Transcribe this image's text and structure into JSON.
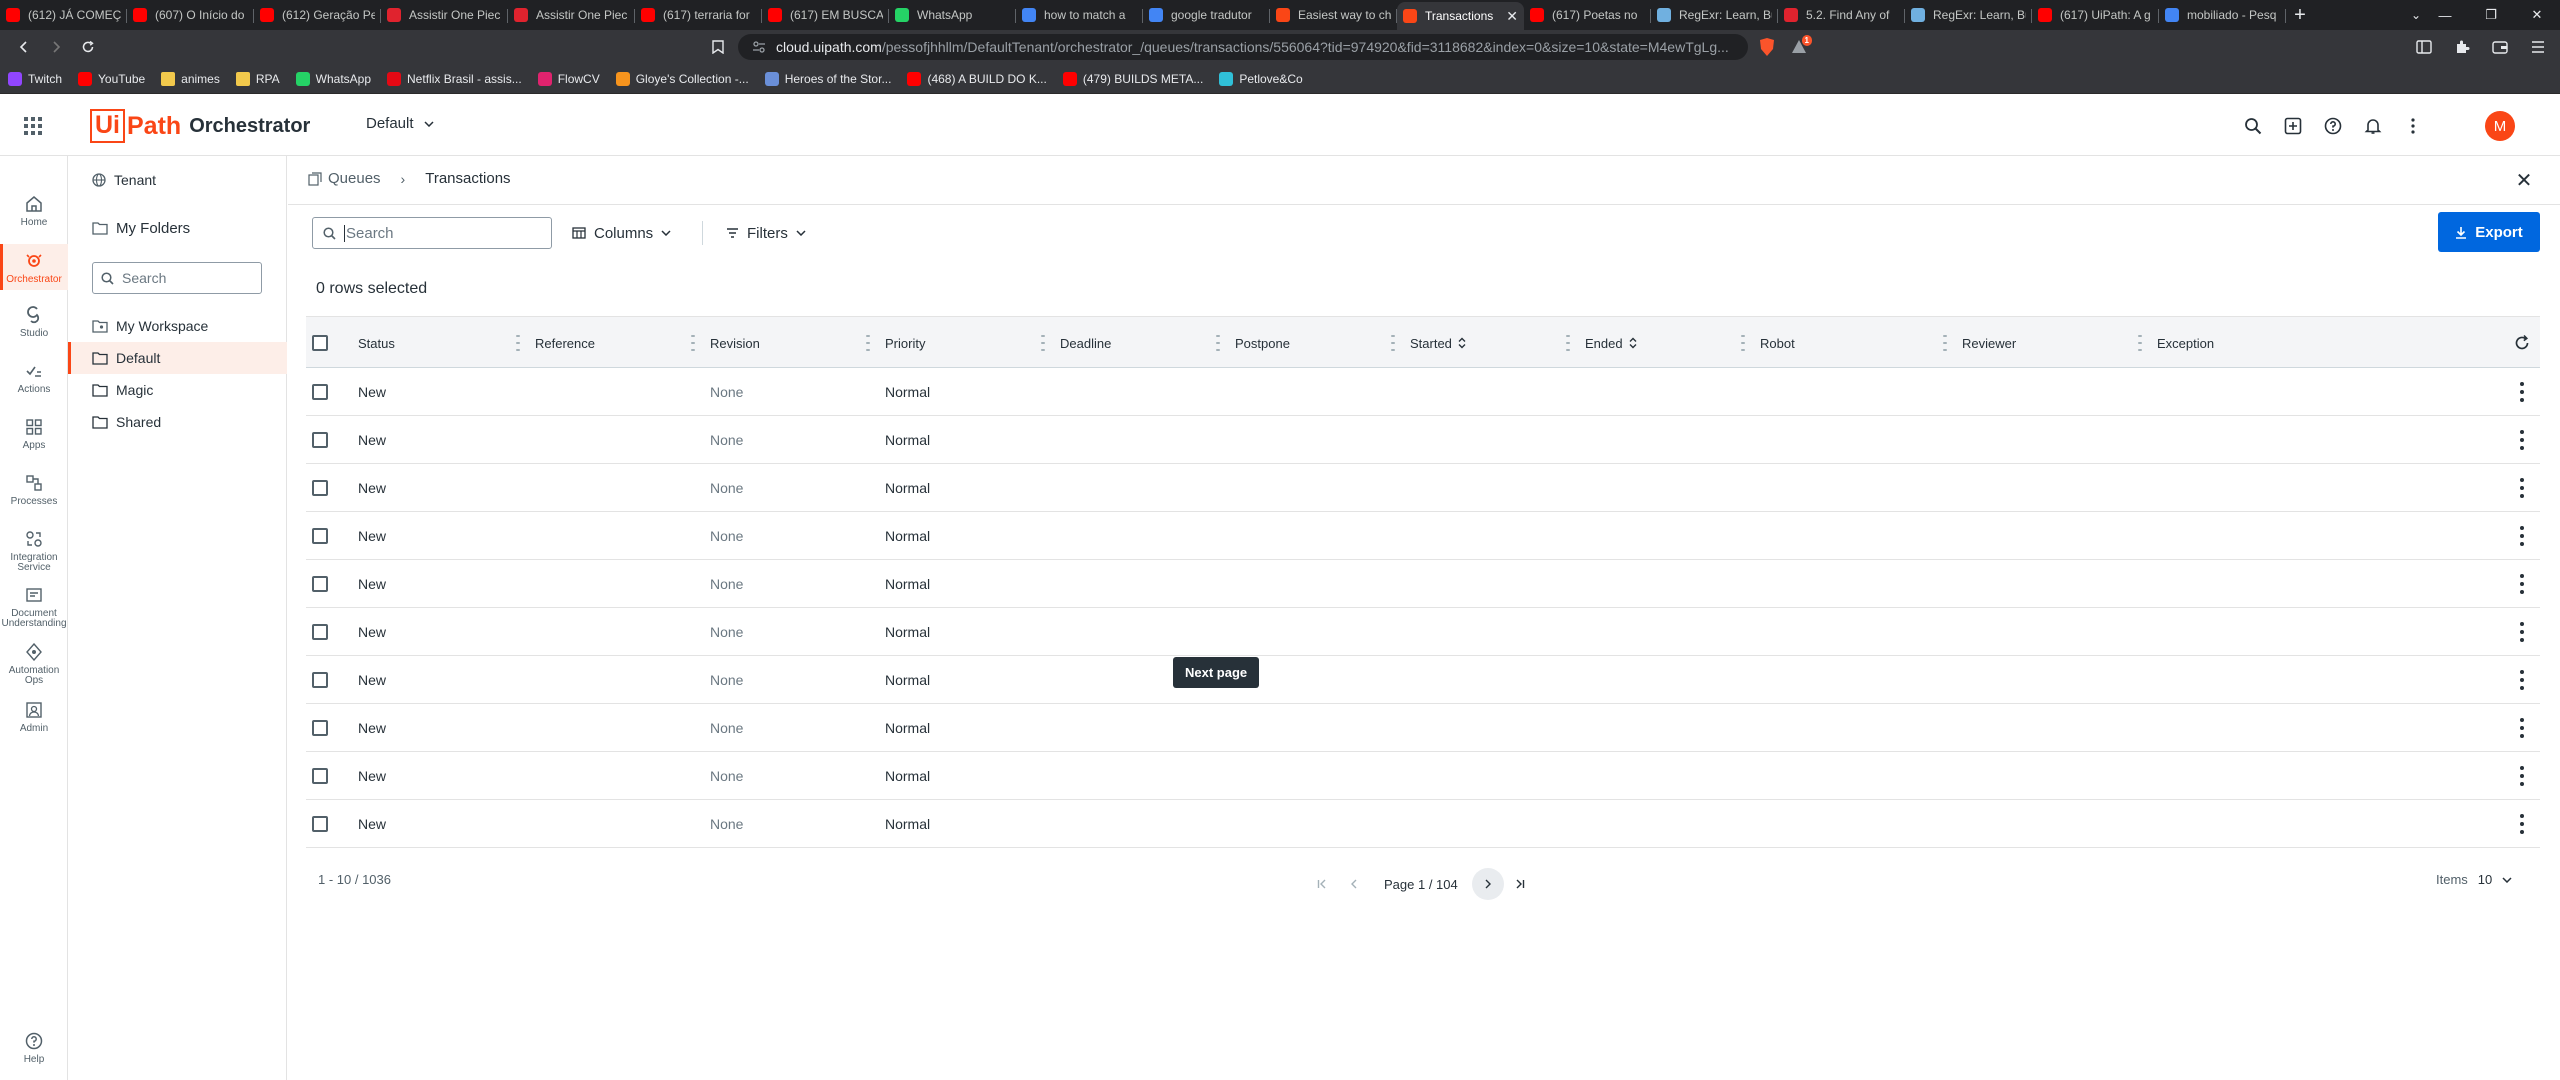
{
  "browser": {
    "tabs": [
      {
        "title": "(612) JÁ COMEÇ",
        "fav": "#ff0000"
      },
      {
        "title": "(607) O Início do",
        "fav": "#ff0000"
      },
      {
        "title": "(612) Geração Pe",
        "fav": "#ff0000"
      },
      {
        "title": "Assistir One Piec",
        "fav": "#e0232e"
      },
      {
        "title": "Assistir One Piec",
        "fav": "#e0232e"
      },
      {
        "title": "(617) terraria for",
        "fav": "#ff0000"
      },
      {
        "title": "(617) EM BUSCA",
        "fav": "#ff0000"
      },
      {
        "title": "WhatsApp",
        "fav": "#25d366"
      },
      {
        "title": "how to match a",
        "fav": "#4285f4"
      },
      {
        "title": "google tradutor",
        "fav": "#4285f4"
      },
      {
        "title": "Easiest way to ch",
        "fav": "#fa4616"
      },
      {
        "title": "Transactions",
        "fav": "#fa4616",
        "active": true
      },
      {
        "title": "(617) Poetas no",
        "fav": "#ff0000"
      },
      {
        "title": "RegExr: Learn, Bu",
        "fav": "#70b0e0"
      },
      {
        "title": "5.2. Find Any of",
        "fav": "#e0232e"
      },
      {
        "title": "RegExr: Learn, Bu",
        "fav": "#70b0e0"
      },
      {
        "title": "(617) UiPath: A g",
        "fav": "#ff0000"
      },
      {
        "title": "mobiliado - Pesq",
        "fav": "#4285f4"
      }
    ],
    "tab_close": "✕",
    "new_tab": "+",
    "url_host": "cloud.uipath.com",
    "url_path": "/pessofjhhllm/DefaultTenant/orchestrator_/queues/transactions/556064?tid=974920&fid=3118682&index=0&size=10&state=M4ewTgLg...",
    "brave_badge": "1",
    "bookmarks": [
      {
        "label": "Twitch",
        "color": "#9146ff"
      },
      {
        "label": "YouTube",
        "color": "#ff0000"
      },
      {
        "label": "animes",
        "color": "#f2c94c",
        "folder": true
      },
      {
        "label": "RPA",
        "color": "#f2c94c",
        "folder": true
      },
      {
        "label": "WhatsApp",
        "color": "#25d366"
      },
      {
        "label": "Netflix Brasil - assis...",
        "color": "#e50914"
      },
      {
        "label": "FlowCV",
        "color": "#e0236e"
      },
      {
        "label": "Gloye's Collection -...",
        "color": "#f7941d"
      },
      {
        "label": "Heroes of the Stor...",
        "color": "#6a8fd8"
      },
      {
        "label": "(468) A BUILD DO K...",
        "color": "#ff0000"
      },
      {
        "label": "(479) BUILDS META...",
        "color": "#ff0000"
      },
      {
        "label": "Petlove&Co",
        "color": "#30c0d8"
      }
    ]
  },
  "header": {
    "logo_ui": "Ui",
    "logo_path": "Path",
    "product": "Orchestrator",
    "tenant": "Default",
    "avatar_letter": "M",
    "brand_color": "#fa4616"
  },
  "rail": [
    {
      "label": "Home",
      "icon": "home-icon"
    },
    {
      "label": "Orchestrator",
      "icon": "orchestrator-icon",
      "active": true
    },
    {
      "label": "Studio",
      "icon": "studio-icon"
    },
    {
      "label": "Actions",
      "icon": "actions-icon"
    },
    {
      "label": "Apps",
      "icon": "apps-icon"
    },
    {
      "label": "Processes",
      "icon": "processes-icon"
    },
    {
      "label": "Integration Service",
      "icon": "integration-icon"
    },
    {
      "label": "Document Understanding",
      "icon": "document-icon"
    },
    {
      "label": "Automation Ops",
      "icon": "automation-ops-icon"
    },
    {
      "label": "Admin",
      "icon": "admin-icon"
    }
  ],
  "rail_help": "Help",
  "folders": {
    "tenant": "Tenant",
    "my_folders": "My Folders",
    "search_placeholder": "Search",
    "items": [
      "My Workspace",
      "Default",
      "Magic",
      "Shared"
    ],
    "selected": "Default"
  },
  "main": {
    "breadcrumb_parent": "Queues",
    "breadcrumb_sep": "›",
    "breadcrumb_current": "Transactions",
    "close": "✕",
    "search_placeholder": "Search",
    "columns_label": "Columns",
    "filters_label": "Filters",
    "export_label": "Export",
    "rows_selected": "0 rows selected"
  },
  "grid": {
    "columns": [
      "Status",
      "Reference",
      "Revision",
      "Priority",
      "Deadline",
      "Postpone",
      "Started",
      "Ended",
      "Robot",
      "Reviewer",
      "Exception"
    ],
    "sortable": [
      "Started",
      "Ended"
    ],
    "rows": [
      {
        "status": "New",
        "revision": "None",
        "priority": "Normal"
      },
      {
        "status": "New",
        "revision": "None",
        "priority": "Normal"
      },
      {
        "status": "New",
        "revision": "None",
        "priority": "Normal"
      },
      {
        "status": "New",
        "revision": "None",
        "priority": "Normal"
      },
      {
        "status": "New",
        "revision": "None",
        "priority": "Normal"
      },
      {
        "status": "New",
        "revision": "None",
        "priority": "Normal"
      },
      {
        "status": "New",
        "revision": "None",
        "priority": "Normal"
      },
      {
        "status": "New",
        "revision": "None",
        "priority": "Normal"
      },
      {
        "status": "New",
        "revision": "None",
        "priority": "Normal"
      },
      {
        "status": "New",
        "revision": "None",
        "priority": "Normal"
      }
    ]
  },
  "footer": {
    "range": "1 - 10 / 1036",
    "page_label": "Page 1 / 104",
    "items_label": "Items",
    "items_value": "10",
    "tooltip": "Next page"
  }
}
